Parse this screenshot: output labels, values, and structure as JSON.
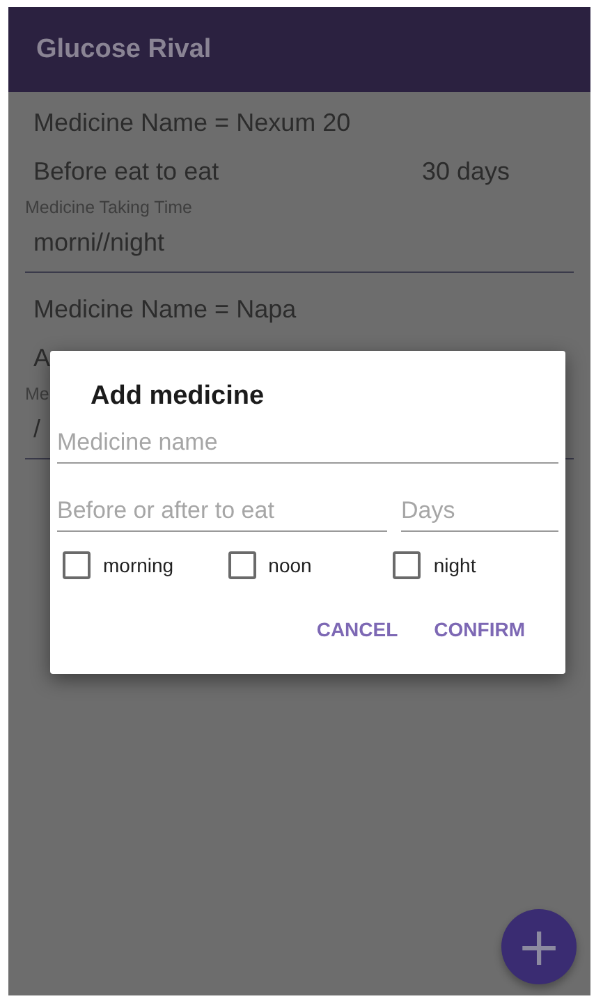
{
  "app_bar": {
    "title": "Glucose Rival"
  },
  "medicines": [
    {
      "name": "Medicine Name = Nexum 20",
      "timing": "Before eat to eat",
      "days": "30 days",
      "time_label": "Medicine Taking Time",
      "time_value": "morni//night"
    },
    {
      "name": "Medicine Name = Napa",
      "timing": "A",
      "time_label": "Me",
      "time_value": "/"
    }
  ],
  "dialog": {
    "title": "Add medicine",
    "fields": [
      {
        "placeholder": "Medicine name"
      },
      {
        "placeholder": "Before or after to eat"
      },
      {
        "placeholder": "Days"
      }
    ],
    "checkboxes": [
      {
        "label": "morning",
        "checked": false
      },
      {
        "label": "noon",
        "checked": false
      },
      {
        "label": "night",
        "checked": false
      }
    ],
    "buttons": [
      "CANCEL",
      "CONFIRM"
    ]
  },
  "fab": {
    "label": "+"
  }
}
